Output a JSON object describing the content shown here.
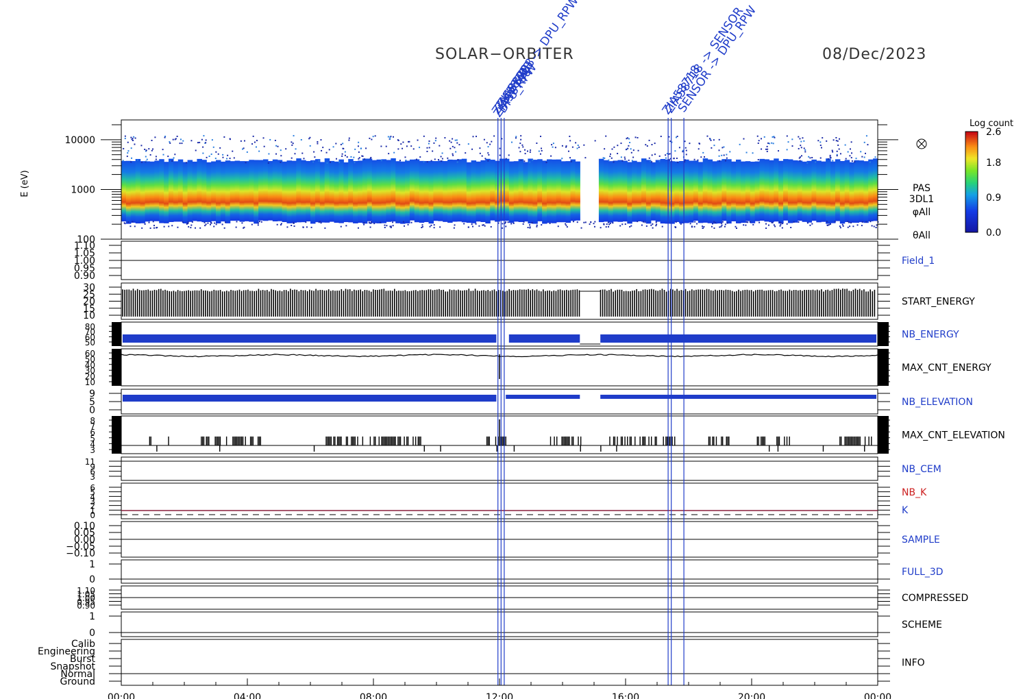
{
  "header": {
    "mission": "SOLAR−ORBITER",
    "date": "08/Dec/2023",
    "event_labels": [
      "ZIA5870B",
      "ZIA58708",
      "DPU_RPW",
      "ZIA58718",
      "SENSOR"
    ]
  },
  "colors": {
    "blue_label": "#1f3cc9",
    "red_label": "#cc1f1f",
    "black": "#000000",
    "event_line": "#1f3cc9",
    "k_line": "#8a1f3c"
  },
  "chart_data": {
    "type": "heatmap",
    "x_axis": {
      "tick_labels": [
        "00:00",
        "04:00",
        "08:00",
        "12:00",
        "16:00",
        "20:00",
        "00:00"
      ],
      "range_hours": [
        0,
        24
      ]
    },
    "event_lines_hours": [
      11.95,
      12.05,
      12.15,
      17.35,
      17.45,
      17.85
    ],
    "spectrogram": {
      "ylabel": "E (eV)",
      "y_scale": "log",
      "y_ticks": [
        "10000",
        "1000",
        "100"
      ],
      "right_labels": [
        "PAS",
        "3DL1",
        "φAll",
        "θAll"
      ],
      "colorbar": {
        "title": "Log count",
        "ticks": [
          "2.6",
          "1.8",
          "0.9",
          "0.0"
        ],
        "range": [
          0,
          2.6
        ]
      },
      "peak_energy_ev": 700,
      "band_range_ev": [
        250,
        3500
      ],
      "gap_hours": [
        14.55,
        15.2
      ]
    },
    "panels": [
      {
        "name": "Field_1",
        "label_color": "blue",
        "ticks": [
          "1.10",
          "1.05",
          "1.00",
          "0.95",
          "0.90"
        ],
        "value": 1.0
      },
      {
        "name": "START_ENERGY",
        "label_color": "black",
        "ticks": [
          "30",
          "25",
          "20",
          "15",
          "10"
        ],
        "bars_from": 10,
        "bars_to": [
          29,
          31
        ]
      },
      {
        "name": "NB_ENERGY",
        "label_color": "blue",
        "ticks": [
          "80",
          "70",
          "60",
          "50"
        ],
        "value": 56
      },
      {
        "name": "MAX_CNT_ENERGY",
        "label_color": "black",
        "ticks": [
          "60",
          "50",
          "40",
          "30",
          "20",
          "10"
        ],
        "value": 57
      },
      {
        "name": "NB_ELEVATION",
        "label_color": "blue",
        "ticks": [
          "9",
          "5",
          "0"
        ],
        "value_before_noon": 9,
        "value_after_noon": 9
      },
      {
        "name": "MAX_CNT_ELEVATION",
        "label_color": "black",
        "ticks": [
          "8",
          "7",
          "6",
          "5",
          "4",
          "3"
        ],
        "values": [
          4,
          5,
          3
        ]
      },
      {
        "name": "NB_CEM",
        "label_color": "blue",
        "ticks": [
          "11",
          "9",
          "6",
          "3"
        ],
        "value": 11
      },
      {
        "name": "NB_K",
        "label_color": "red",
        "ticks": [
          "6",
          "5",
          "4",
          "3",
          "2",
          "1",
          "0"
        ],
        "value": 1,
        "second_name": "K"
      },
      {
        "name": "SAMPLE",
        "label_color": "blue",
        "ticks": [
          "0.10",
          "0.05",
          "0.00",
          "−0.05",
          "−0.10"
        ],
        "value": 0
      },
      {
        "name": "FULL_3D",
        "label_color": "blue",
        "ticks": [
          "1",
          "0"
        ],
        "value": 0
      },
      {
        "name": "COMPRESSED",
        "label_color": "black",
        "ticks": [
          "1.10",
          "1.05",
          "1.00",
          "0.95",
          "0.90"
        ],
        "value": 1.0
      },
      {
        "name": "SCHEME",
        "label_color": "black",
        "ticks": [
          "1",
          "0"
        ],
        "value": 0
      },
      {
        "name": "INFO",
        "label_color": "black",
        "ticks": [
          "Calib",
          "Engineering",
          "Burst",
          "Snapshot",
          "Normal",
          "Ground"
        ],
        "value": "Normal"
      }
    ]
  }
}
